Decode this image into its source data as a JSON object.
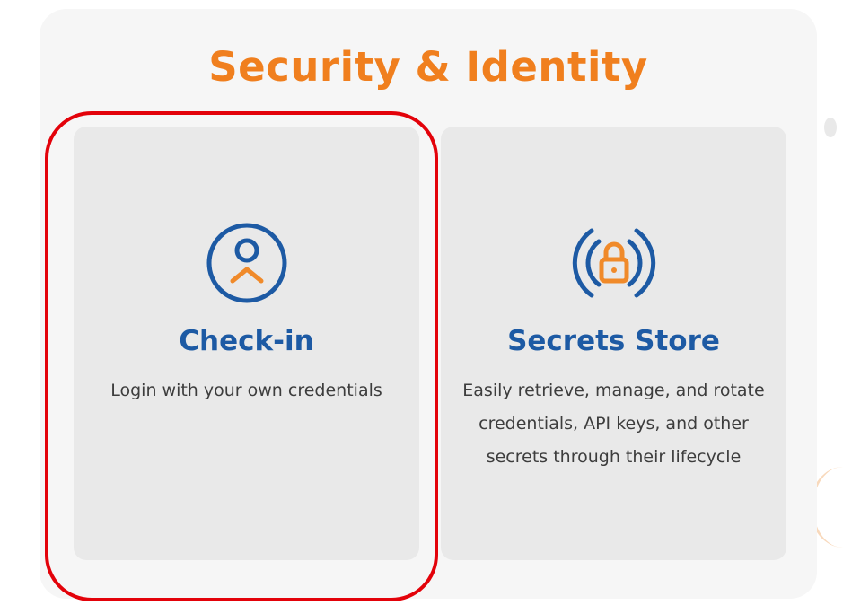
{
  "section": {
    "title": "Security & Identity"
  },
  "cards": [
    {
      "id": "checkin",
      "title": "Check-in",
      "description": "Login with your own credentials",
      "icon": "user-circle-icon"
    },
    {
      "id": "secrets",
      "title": "Secrets Store",
      "description": "Easily retrieve, manage, and rotate credentials, API keys, and other secrets through their lifecycle",
      "icon": "lock-signal-icon"
    }
  ],
  "colors": {
    "title_orange": "#f07f1e",
    "card_title_blue": "#1d5aa4",
    "icon_orange": "#f08a2a",
    "highlight_red": "#e3020a",
    "panel_bg": "#f6f6f6",
    "card_bg": "#e9e9e9"
  }
}
